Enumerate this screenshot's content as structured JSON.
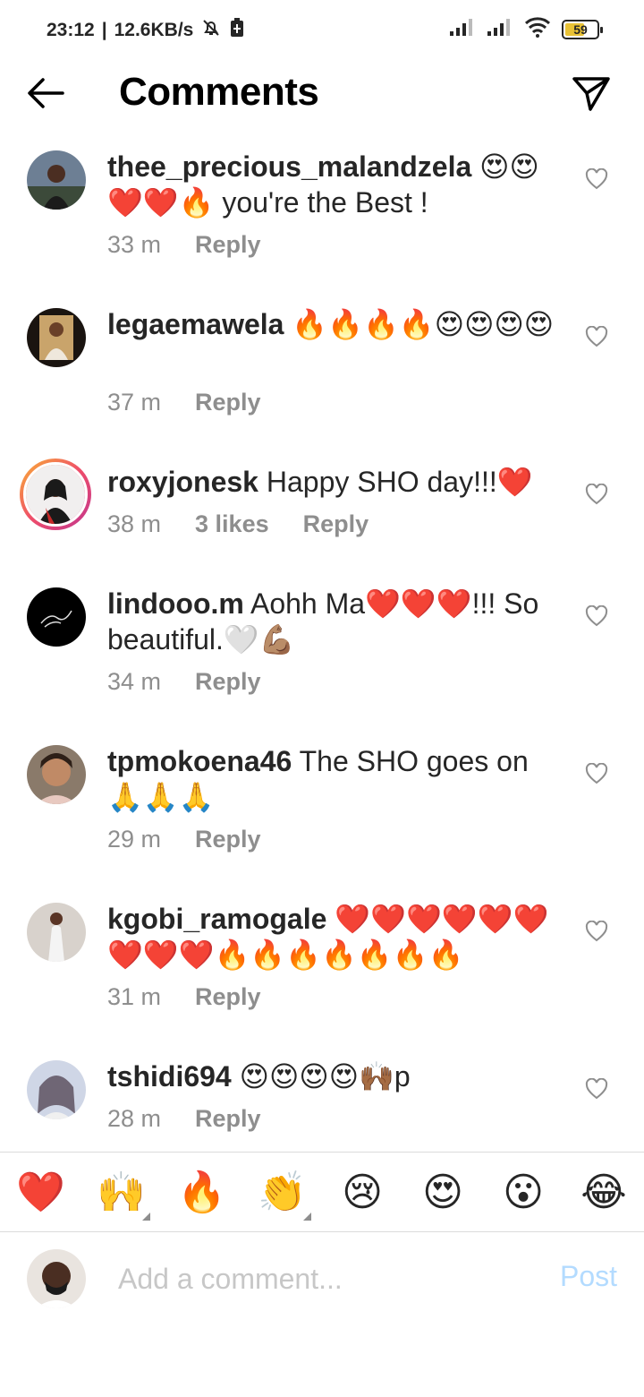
{
  "status_bar": {
    "time": "23:12",
    "network_speed": "12.6KB/s",
    "battery_level": "59",
    "icons": [
      "silent-mode-icon",
      "battery-saver-icon",
      "signal-icon",
      "signal-icon",
      "wifi-icon",
      "battery-icon"
    ]
  },
  "header": {
    "title": "Comments",
    "back_icon": "arrow-left-icon",
    "share_icon": "paper-plane-icon"
  },
  "comments": [
    {
      "username": "thee_precious_malandzela",
      "text": "😍😍❤️❤️🔥 you're the Best !",
      "time": "33 m",
      "likes": "",
      "reply": "Reply"
    },
    {
      "username": "legaemawela",
      "text": "🔥🔥🔥🔥😍😍😍😍",
      "time": "37 m",
      "likes": "",
      "reply": "Reply"
    },
    {
      "username": "roxyjonesk",
      "text": "Happy SHO day!!!❤️",
      "time": "38 m",
      "likes": "3 likes",
      "reply": "Reply"
    },
    {
      "username": "lindooo.m",
      "text": "Aohh Ma❤️❤️❤️!!! So beautiful.🤍💪🏽",
      "time": "34 m",
      "likes": "",
      "reply": "Reply"
    },
    {
      "username": "tpmokoena46",
      "text": "The SHO goes on 🙏🙏🙏",
      "time": "29 m",
      "likes": "",
      "reply": "Reply"
    },
    {
      "username": "kgobi_ramogale",
      "text": "❤️❤️❤️❤️❤️❤️❤️❤️❤️🔥🔥🔥🔥🔥🔥🔥",
      "time": "31 m",
      "likes": "",
      "reply": "Reply"
    },
    {
      "username": "tshidi694",
      "text": "😍😍😍😍🙌🏾p",
      "time": "28 m",
      "likes": "",
      "reply": "Reply"
    }
  ],
  "quick_emojis": [
    "❤️",
    "🙌",
    "🔥",
    "👏",
    "😢",
    "😍",
    "😮",
    "😂"
  ],
  "composer": {
    "placeholder": "Add a comment...",
    "post_label": "Post"
  },
  "colors": {
    "text": "#262626",
    "muted": "#8e8e8e",
    "post_disabled": "#b3dbff",
    "battery_fill": "#e9c235"
  }
}
